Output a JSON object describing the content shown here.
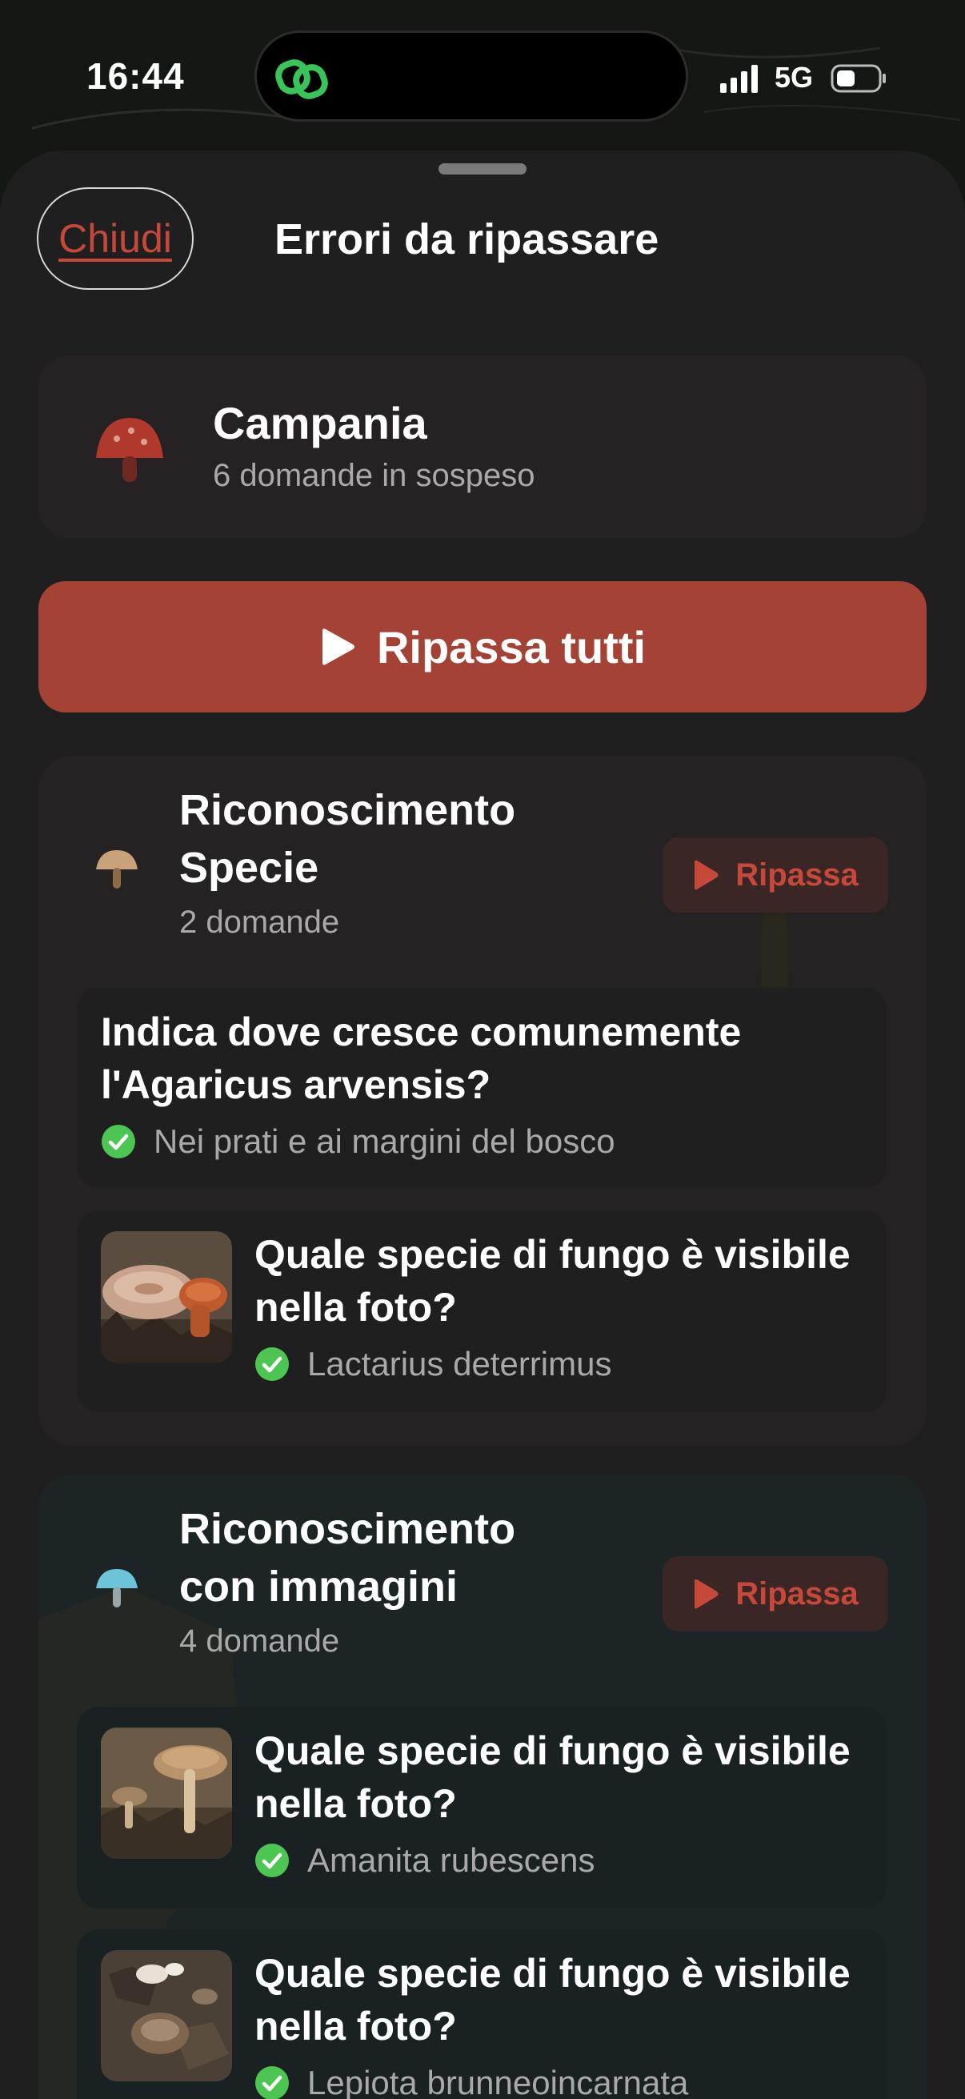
{
  "status_bar": {
    "time": "16:44",
    "network": "5G",
    "island_icon": "link-icon"
  },
  "sheet": {
    "close_label": "Chiudi",
    "title": "Errori da ripassare"
  },
  "region": {
    "name": "Campania",
    "pending": "6 domande in sospeso",
    "icon": "mushroom-red-icon"
  },
  "review_all_label": "Ripassa tutti",
  "sections": [
    {
      "title_line1": "Riconoscimento",
      "title_line2": "Specie",
      "count": "2 domande",
      "button_label": "Ripassa",
      "icon": "mushroom-brown-icon",
      "questions": [
        {
          "line1": "Indica dove cresce comunemente",
          "line2": "l'Agaricus arvensis?",
          "answer": "Nei prati e ai margini del bosco"
        },
        {
          "line1": "Quale specie di fungo è visibile",
          "line2": "nella foto?",
          "answer": "Lactarius deterrimus",
          "thumbnail": "mushroom-photo-lactarius"
        }
      ]
    },
    {
      "title_line1": "Riconoscimento",
      "title_line2": "con immagini",
      "count": "4 domande",
      "button_label": "Ripassa",
      "icon": "mushroom-blue-icon",
      "questions": [
        {
          "line1": "Quale specie di fungo è visibile",
          "line2": "nella foto?",
          "answer": "Amanita rubescens",
          "thumbnail": "mushroom-photo-amanita"
        },
        {
          "line1": "Quale specie di fungo è visibile",
          "line2": "nella foto?",
          "answer": "Lepiota brunneoincarnata",
          "thumbnail": "mushroom-photo-lepiota"
        }
      ]
    }
  ],
  "colors": {
    "accent_red": "#a44236",
    "accent_red_text": "#c6483a",
    "check_green": "#4cc552",
    "sheet_bg": "#1f1f1f",
    "section1_bg": "#242222",
    "section2_bg": "#1d2426"
  }
}
